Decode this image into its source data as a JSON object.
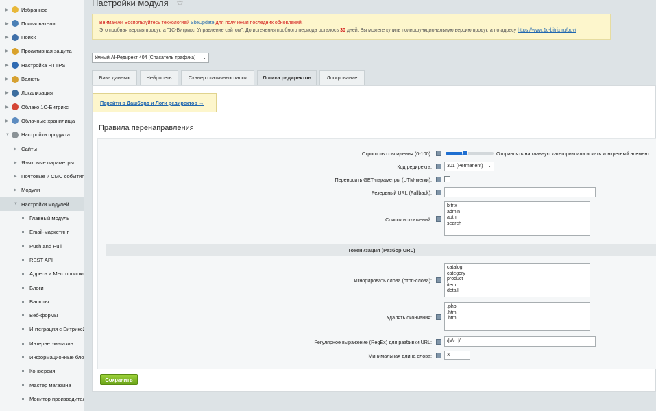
{
  "sidebar": {
    "items": [
      {
        "label": "Избранное",
        "icon": "star-icon",
        "color": "#e8b83a"
      },
      {
        "label": "Пользователи",
        "icon": "user-icon",
        "color": "#4a7fb5"
      },
      {
        "label": "Поиск",
        "icon": "search-icon",
        "color": "#3f6fa8"
      },
      {
        "label": "Проактивная защита",
        "icon": "lock-icon",
        "color": "#d9a22c"
      },
      {
        "label": "Настройка HTTPS",
        "icon": "shield-icon",
        "color": "#2f6bb3"
      },
      {
        "label": "Валюты",
        "icon": "coin-icon",
        "color": "#d6a131"
      },
      {
        "label": "Локализация",
        "icon": "globe-icon",
        "color": "#3c6d9e"
      },
      {
        "label": "Облако 1С-Битрикс",
        "icon": "cloud-icon",
        "color": "#d44535"
      },
      {
        "label": "Облачные хранилища",
        "icon": "storage-icon",
        "color": "#5d8cc0"
      },
      {
        "label": "Настройки продукта",
        "icon": "gear-icon",
        "color": "#8a9296"
      }
    ],
    "sub_items": [
      "Сайты",
      "Языковые параметры",
      "Почтовые и СМС события",
      "Модули",
      "Настройки модулей"
    ],
    "module_items": [
      "Главный модуль",
      "Email-маркетинг",
      "Push and Pull",
      "REST API",
      "Адреса и Местоположе",
      "Блоги",
      "Валюты",
      "Веб-формы",
      "Интеграция с Битрикс2",
      "Интернет-магазин",
      "Информационные блок",
      "Конверсия",
      "Мастер магазина",
      "Монитор производител"
    ]
  },
  "header": {
    "title": "Настройки модуля"
  },
  "notice": {
    "line1_pre": "Внимание! Воспользуйтесь технологией ",
    "line1_link": "SiteUpdate",
    "line1_post": " для получения последних обновлений.",
    "line2_pre": "Это пробная версия продукта \"1С-Битрикс: Управление сайтом\". До истечения пробного периода осталось ",
    "days": "30",
    "line2_mid": " дней. Вы можете купить полнофункциональную версию продукта по адресу ",
    "line2_link": "https://www.1c-bitrix.ru/buy/"
  },
  "module_select": {
    "value": "Умный AI-Редирект 404 (Спасатель трафика)"
  },
  "tabs": [
    {
      "label": "База данных",
      "active": false
    },
    {
      "label": "Нейросеть",
      "active": false
    },
    {
      "label": "Сканер статичных папок",
      "active": false
    },
    {
      "label": "Логика редиректов",
      "active": true
    },
    {
      "label": "Логирование",
      "active": false
    }
  ],
  "dashboard_link": "Перейти в Дашборд и Логи редиректов →",
  "section_title": "Правила перенаправления",
  "form": {
    "strictness": {
      "label": "Строгость совпадения (0-100):",
      "value": 40,
      "max": 100,
      "note": "Отправлять на главную категорию или искать конкретный элемент"
    },
    "redirect_code": {
      "label": "Код редиректа:",
      "value": "301 (Permanent)"
    },
    "pass_get": {
      "label": "Переносить GET-параметры (UTM-метки):",
      "checked": false
    },
    "fallback": {
      "label": "Резервный URL (Fallback):",
      "value": ""
    },
    "exclusions": {
      "label": "Список исключений:",
      "value": "bitrix\nadmin\nauth\nsearch"
    },
    "tokenization_heading": "Токенизация (Разбор URL)",
    "stop_words": {
      "label": "Игнорировать слова (стоп-слова):",
      "value": "catalog\ncategory\nproduct\nitem\ndetail"
    },
    "endings": {
      "label": "Удалять окончания:",
      "value": ".php\n.html\n.htm"
    },
    "regex": {
      "label": "Регулярное выражение (RegEx) для разбивки URL:",
      "value": "/[\\/\\-_]/"
    },
    "min_length": {
      "label": "Минимальная длина слова:",
      "value": "3"
    }
  },
  "save_label": "Сохранить"
}
